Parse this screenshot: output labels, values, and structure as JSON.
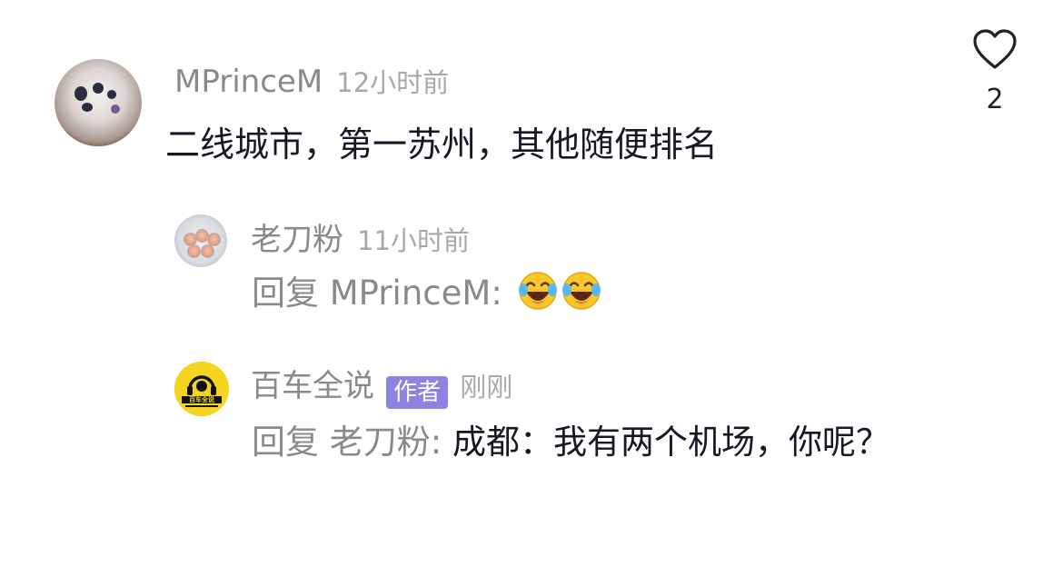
{
  "comment": {
    "username": "MPrinceM",
    "time": "12小时前",
    "text": "二线城市，第一苏州，其他随便排名",
    "like_count": "2"
  },
  "replies": [
    {
      "username": "老刀粉",
      "time": "11小时前",
      "reply_prefix": "回复 MPrinceM:",
      "emojis": [
        "laughing-with-tears-emoji",
        "laughing-with-tears-emoji"
      ]
    },
    {
      "username": "百车全说",
      "badge": "作者",
      "time": "刚刚",
      "reply_prefix": "回复 老刀粉:",
      "text": "成都：我有两个机场，你呢？",
      "avatar_text": "百车全说"
    }
  ],
  "colors": {
    "badge": "#8b84e3",
    "username": "#8a8a8a",
    "text": "#161823"
  }
}
